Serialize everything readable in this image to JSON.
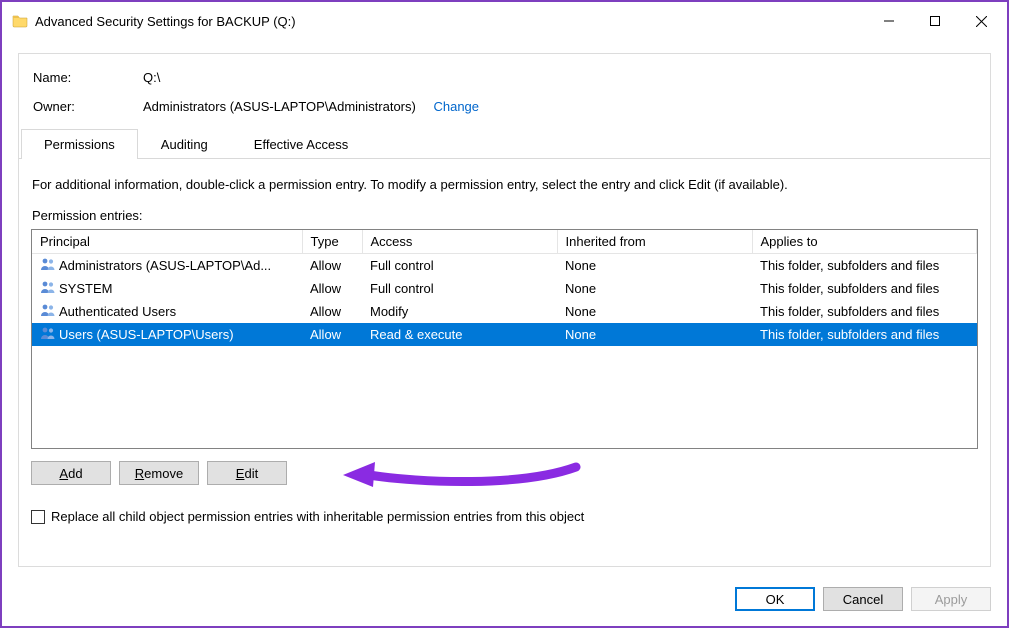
{
  "window_title": "Advanced Security Settings for BACKUP (Q:)",
  "info": {
    "name_label": "Name:",
    "name_value": "Q:\\",
    "owner_label": "Owner:",
    "owner_value": "Administrators (ASUS-LAPTOP\\Administrators)",
    "change_link": "Change"
  },
  "tabs": {
    "permissions": "Permissions",
    "auditing": "Auditing",
    "effective": "Effective Access",
    "active": "permissions"
  },
  "instructions": "For additional information, double-click a permission entry. To modify a permission entry, select the entry and click Edit (if available).",
  "entries_label": "Permission entries:",
  "columns": {
    "principal": "Principal",
    "type": "Type",
    "access": "Access",
    "inherited": "Inherited from",
    "applies": "Applies to"
  },
  "rows": [
    {
      "principal": "Administrators (ASUS-LAPTOP\\Ad...",
      "type": "Allow",
      "access": "Full control",
      "inherited": "None",
      "applies": "This folder, subfolders and files",
      "selected": false
    },
    {
      "principal": "SYSTEM",
      "type": "Allow",
      "access": "Full control",
      "inherited": "None",
      "applies": "This folder, subfolders and files",
      "selected": false
    },
    {
      "principal": "Authenticated Users",
      "type": "Allow",
      "access": "Modify",
      "inherited": "None",
      "applies": "This folder, subfolders and files",
      "selected": false
    },
    {
      "principal": "Users (ASUS-LAPTOP\\Users)",
      "type": "Allow",
      "access": "Read & execute",
      "inherited": "None",
      "applies": "This folder, subfolders and files",
      "selected": true
    }
  ],
  "buttons": {
    "add": "Add",
    "remove": "Remove",
    "edit": "Edit"
  },
  "checkbox_label": "Replace all child object permission entries with inheritable permission entries from this object",
  "footer": {
    "ok": "OK",
    "cancel": "Cancel",
    "apply": "Apply"
  },
  "colors": {
    "selection": "#0078d7",
    "annotation": "#8a2be2"
  }
}
